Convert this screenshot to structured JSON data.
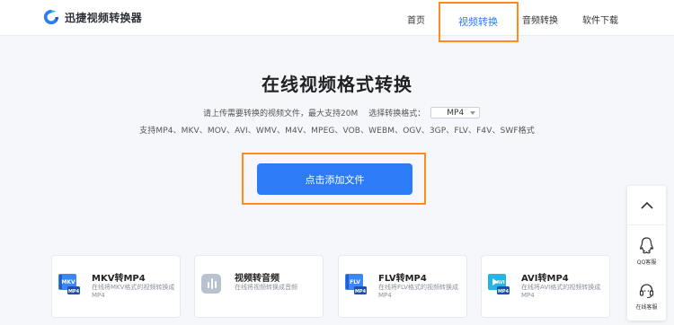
{
  "header": {
    "logo_text": "迅捷视频转换器",
    "nav": [
      {
        "label": "首页"
      },
      {
        "label": "视频转换"
      },
      {
        "label": "音频转换"
      },
      {
        "label": "软件下载"
      }
    ],
    "active_nav": "视频转换"
  },
  "main": {
    "title": "在线视频格式转换",
    "upload_hint": "请上传需要转换的视频文件，最大支持20M",
    "select_format_label": "选择转换格式：",
    "selected_format": "MP4",
    "supported_formats": "支持MP4、MKV、MOV、AVI、WMV、M4V、MPEG、VOB、WEBM、OGV、3GP、FLV、F4V、SWF格式",
    "add_file_button": "点击添加文件"
  },
  "cards": [
    {
      "title": "MKV转MP4",
      "desc": "在线将MKV格式的视频转换成MP4",
      "badge_top": "MKV",
      "badge_bottom": "MP4",
      "icon": "mkv-to-mp4-icon"
    },
    {
      "title": "视频转音频",
      "desc": "在线将视频转换成音频",
      "icon": "video-to-audio-icon"
    },
    {
      "title": "FLV转MP4",
      "desc": "在线将FLV格式的视频转换成MP4",
      "badge_top": "FLV",
      "badge_bottom": "MP4",
      "icon": "flv-to-mp4-icon"
    },
    {
      "title": "AVI转MP4",
      "desc": "在线将AVI格式的视频转换成MP4",
      "badge_top": "AVI",
      "badge_bottom": "MP4",
      "icon": "avi-to-mp4-icon"
    }
  ],
  "sidebar": {
    "qq_label": "QQ客服",
    "online_label": "在线客服"
  },
  "colors": {
    "accent": "#2b7cf6",
    "highlight": "#ff8a1f"
  }
}
